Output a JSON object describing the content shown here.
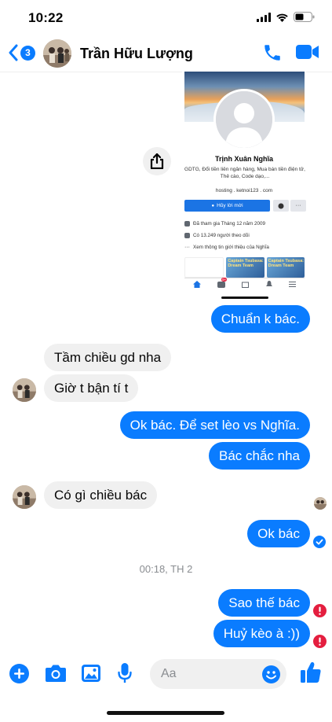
{
  "status_bar": {
    "time": "10:22"
  },
  "header": {
    "back_badge": "3",
    "contact_name": "Trần Hữu Lượng",
    "accent_color": "#0a7cff"
  },
  "shared_screenshot": {
    "profile_name": "Trịnh Xuân Nghĩa",
    "bio": "GDTG, Đổi tiền liên ngân hàng, Mua bán tiền điện tử, Thẻ cào, Code dạo,...",
    "link": "hosting . ketnoi123 . com",
    "button_label": "Hủy lời mời",
    "joined": "Đã tham gia Tháng 12 năm 2009",
    "followers": "Có 13.249 người theo dõi",
    "about": "Xem thông tin giới thiệu của Nghĩa",
    "thumb_1": "Captain Tsubasa: Dream Team",
    "thumb_2": "Captain Tsubasa: Dream Team",
    "tab_badge": "9+"
  },
  "messages": [
    {
      "direction": "outgoing",
      "text": "Chuẩn k bác."
    },
    {
      "direction": "incoming",
      "text": "Tầm chiều gd nha"
    },
    {
      "direction": "incoming",
      "text": "Giờ t bận tí t"
    },
    {
      "direction": "outgoing",
      "text": "Ok bác. Để set lèo vs Nghĩa."
    },
    {
      "direction": "outgoing",
      "text": "Bác chắc nha"
    },
    {
      "direction": "incoming",
      "text": "Có gì chiều bác"
    },
    {
      "direction": "outgoing",
      "text": "Ok bác"
    },
    {
      "direction": "outgoing",
      "text": "Sao thế bác"
    },
    {
      "direction": "outgoing",
      "text": "Huỷ kèo à :))"
    }
  ],
  "timestamp": "00:18, TH 2",
  "composer": {
    "placeholder": "Aa"
  },
  "colors": {
    "outgoing_bubble": "#0a7cff",
    "incoming_bubble": "#f0f0f0",
    "error": "#e41e3f"
  }
}
